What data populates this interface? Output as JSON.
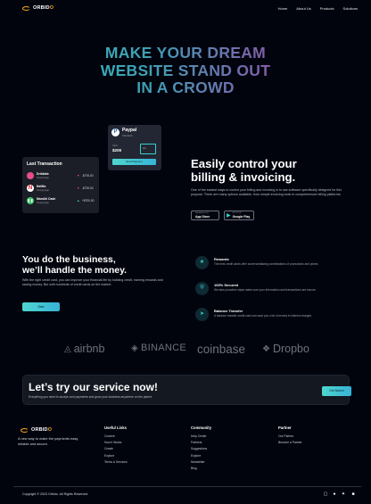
{
  "nav": {
    "logo": "ORBIDO",
    "logo_main": "ORBID",
    "logo_accent": "O",
    "links": [
      "Home",
      "About Us",
      "Products",
      "Solutions"
    ]
  },
  "hero": {
    "line1": "MAKE YOUR DREAM",
    "line2": "WEBSITE STAND OUT",
    "line3": "IN A CROWD"
  },
  "paypal_card": {
    "icon": "P",
    "title": "Paypal",
    "subtitle": "Standard",
    "label": "Card",
    "amount": "$200",
    "box": "Vis.",
    "button": "Send Payment"
  },
  "transactions": {
    "title": "Last Transaction",
    "items": [
      {
        "name": "Dribbble",
        "sub": "Designpage",
        "amount": "-$700,00",
        "dir": "▼",
        "color": "#ea4c89",
        "dir_color": "#e0475b",
        "icon": "dribbble-icon"
      },
      {
        "name": "Netflix",
        "sub": "Designpage",
        "amount": "-$700,00",
        "dir": "▼",
        "color": "#e50914",
        "dir_color": "#e0475b",
        "icon": "netflix-icon"
      },
      {
        "name": "Mandiri Cash",
        "sub": "Designpage",
        "amount": "+$700,00",
        "dir": "▲",
        "color": "#3ec76a",
        "dir_color": "#36d1d1",
        "icon": "pause-icon"
      }
    ]
  },
  "billing": {
    "heading_line1": "Easily control your",
    "heading_line2": "billing & invoicing.",
    "text": "One of the easiest ways to control your billing and invoicing is to use software specifically designed for this purpose. There are many options available, from simple invoicing tools to comprehensive billing platforms.",
    "app_store": {
      "small": "Download on the",
      "big": "App Store"
    },
    "google_play": {
      "small": "GET IT ON",
      "big": "Google Play"
    }
  },
  "business": {
    "heading_line1": "You do the business,",
    "heading_line2": "we’ll handle the money.",
    "text": "With the right credit card, you can improve your financial life by building credit, earning rewards and saving money. But with hundreds of credit cards on the market.",
    "button": "Start"
  },
  "features": [
    {
      "title": "Rewards",
      "text": "The best credit cards offer some tantalizing combinations of promotions and prizes.",
      "icon": "star-icon"
    },
    {
      "title": "100% Secured",
      "text": "We take proactive steps make sure your information and transactions are secure.",
      "icon": "shield-icon"
    },
    {
      "title": "Balance Transfer",
      "text": "A balance transfer credit card can save you a lot of money in interest charges.",
      "icon": "send-icon"
    }
  ],
  "brands": [
    "airbnb",
    "BINANCE",
    "coinbase",
    "Dropbo"
  ],
  "cta": {
    "heading": "Let’s try our service now!",
    "text": "Everything you need to accept card payments and grow your business anywhere on the planet.",
    "button": "Get Started"
  },
  "footer": {
    "logo": "ORBIDO",
    "description": "A new way to make the payments easy, reliable and secure.",
    "columns": [
      {
        "title": "Useful Links",
        "items": [
          "Content",
          "How it Works",
          "Create",
          "Explore",
          "Terms & Services"
        ]
      },
      {
        "title": "Community",
        "items": [
          "Help Center",
          "Partners",
          "Suggestions",
          "Explore",
          "Newsletter",
          "Blog"
        ]
      },
      {
        "title": "Partner",
        "items": [
          "Our Partner",
          "Become a Partner"
        ]
      }
    ],
    "copyright": "Copyright © 2023 Orbido. All Rights Reserved."
  }
}
